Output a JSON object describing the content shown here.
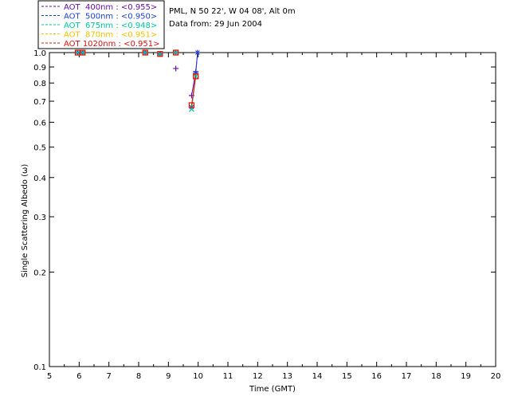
{
  "header": {
    "line1": "PML, N 50 22', W 04 08', Alt 0m",
    "line2": "Data from: 29 Jun 2004"
  },
  "chart_data": {
    "type": "scatter",
    "xlabel": "Time (GMT)",
    "ylabel": "Single Scattering Albedo (ω)",
    "xlim": [
      5,
      20
    ],
    "ylim": [
      0.1,
      1.0
    ],
    "yscale": "log",
    "xticks": [
      "5",
      "6",
      "7",
      "8",
      "9",
      "10",
      "11",
      "12",
      "13",
      "14",
      "15",
      "16",
      "17",
      "18",
      "19",
      "20"
    ],
    "yticks": [
      {
        "v": 1.0,
        "label": "1.0"
      },
      {
        "v": 0.9,
        "label": "0.9"
      },
      {
        "v": 0.8,
        "label": "0.8"
      },
      {
        "v": 0.7,
        "label": "0.7"
      },
      {
        "v": 0.6,
        "label": "0.6"
      },
      {
        "v": 0.5,
        "label": "0.5"
      },
      {
        "v": 0.4,
        "label": "0.4"
      },
      {
        "v": 0.3,
        "label": "0.3"
      },
      {
        "v": 0.2,
        "label": "0.2"
      },
      {
        "v": 0.1,
        "label": "0.1"
      }
    ],
    "legend_position": "top-left, outside plot",
    "series": [
      {
        "name": "AOT  400nm : <0.955>",
        "color": "#6a0dad",
        "marker": "plus",
        "x": [
          5.95,
          6.12,
          8.22,
          8.72,
          9.25,
          9.78,
          9.92,
          9.98
        ],
        "y": [
          1.0,
          1.0,
          1.0,
          0.99,
          0.89,
          0.73,
          0.87,
          1.0
        ]
      },
      {
        "name": "AOT  500nm : <0.950>",
        "color": "#1f3fd1",
        "marker": "asterisk",
        "x": [
          5.95,
          6.12,
          8.22,
          8.72,
          9.25,
          9.78,
          9.92,
          9.98
        ],
        "y": [
          1.0,
          1.0,
          1.0,
          0.99,
          1.0,
          0.67,
          0.86,
          1.0
        ]
      },
      {
        "name": "AOT  675nm : <0.948>",
        "color": "#00c8a0",
        "marker": "cross",
        "x": [
          5.95,
          6.12,
          8.22,
          8.72,
          9.25,
          9.78,
          9.92
        ],
        "y": [
          1.0,
          1.0,
          1.0,
          0.99,
          1.0,
          0.66,
          0.84
        ]
      },
      {
        "name": "AOT  870nm : <0.951>",
        "color": "#f2c200",
        "marker": "square",
        "x": [
          5.95,
          6.12,
          8.22,
          8.72,
          9.25,
          9.78,
          9.92
        ],
        "y": [
          1.0,
          1.0,
          1.0,
          0.99,
          1.0,
          0.68,
          0.84
        ]
      },
      {
        "name": "AOT 1020nm : <0.951>",
        "color": "#e01010",
        "marker": "square",
        "x": [
          5.95,
          6.12,
          8.22,
          8.72,
          9.25,
          9.78,
          9.92
        ],
        "y": [
          1.0,
          1.0,
          1.0,
          0.99,
          1.0,
          0.68,
          0.84
        ]
      }
    ]
  }
}
